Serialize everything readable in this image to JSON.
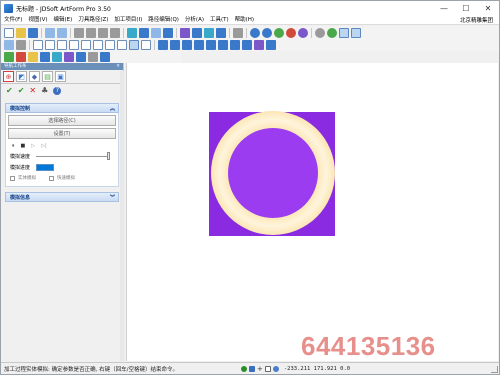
{
  "window": {
    "title": "无标题 - JDSoft ArtForm Pro 3.50",
    "min_glyph": "—",
    "max_glyph": "☐",
    "close_glyph": "✕"
  },
  "menubar": {
    "items": [
      "文件(F)",
      "视图(V)",
      "编辑(E)",
      "刀具路径(Z)",
      "加工项目(I)",
      "路径编辑(Q)",
      "分析(A)",
      "工具(T)",
      "帮助(H)"
    ],
    "right_label": "北京精雕集团"
  },
  "panel": {
    "title": "导航工作条",
    "close_glyph": "✕",
    "tab_glyphs": [
      "⊕",
      "◩",
      "◆",
      "▤",
      "▣"
    ],
    "action_glyphs": [
      "✔",
      "✔",
      "✕",
      "♣",
      "?"
    ],
    "sim_section": {
      "title": "模拟控制",
      "chevron": "︽",
      "select_path_btn": "选择路径(C)",
      "settings_btn": "设置(T)",
      "playback_glyphs": [
        "⏸",
        "■",
        "▷",
        "▷|"
      ],
      "speed_label": "模拟速度",
      "speed_value": 1.0,
      "progress_label": "模拟进度",
      "checkboxes": [
        {
          "label": "实体模拟",
          "checked": false
        },
        {
          "label": "快速模拟",
          "checked": false
        }
      ]
    },
    "info_section": {
      "title": "模拟信息",
      "chevron": "︾"
    }
  },
  "statusbar": {
    "message": "加工过程实体模拟: 确定参数是否正确, 右键（回车/空格键）结束命令。",
    "coordinates": "-233.211 171.921 0.0"
  },
  "watermark": "644135136",
  "colors": {
    "stock_square": "#8a2be2",
    "ring_outer": "#fbe6b4",
    "ring_inner": "#fff4dc",
    "inner_disc": "#9b3cf0",
    "panel_header": "#6a8fb8",
    "section_text": "#15428b"
  }
}
